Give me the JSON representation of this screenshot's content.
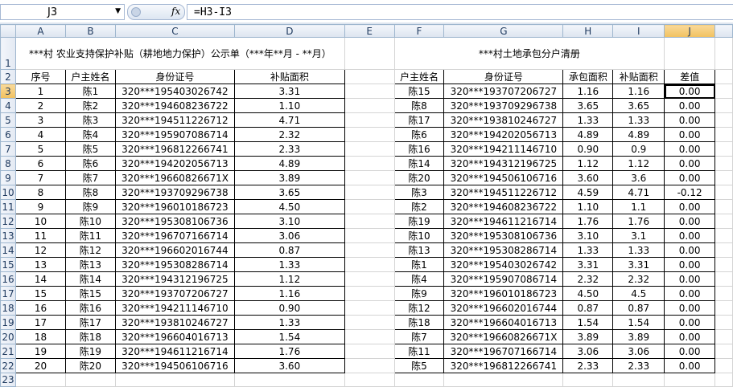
{
  "formula_bar": {
    "name_box": "J3",
    "fx_label": "fx",
    "formula": "=H3-I3"
  },
  "columns": [
    "A",
    "B",
    "C",
    "D",
    "E",
    "F",
    "G",
    "H",
    "I",
    "J"
  ],
  "rows": [
    "1",
    "2",
    "3",
    "4",
    "5",
    "6",
    "7",
    "8",
    "9",
    "10",
    "11",
    "12",
    "13",
    "14",
    "15",
    "16",
    "17",
    "18",
    "19",
    "20",
    "21",
    "22",
    "23"
  ],
  "left_table": {
    "title": "***村 农业支持保护补贴（耕地地力保护）公示单（***年**月 - **月）",
    "headers": [
      "序号",
      "户主姓名",
      "身份证号",
      "补贴面积"
    ],
    "rows": [
      [
        "1",
        "陈1",
        "320***195403026742",
        "3.31"
      ],
      [
        "2",
        "陈2",
        "320***194608236722",
        "1.10"
      ],
      [
        "3",
        "陈3",
        "320***194511226712",
        "4.71"
      ],
      [
        "4",
        "陈4",
        "320***195907086714",
        "2.32"
      ],
      [
        "5",
        "陈5",
        "320***196812266741",
        "2.33"
      ],
      [
        "6",
        "陈6",
        "320***194202056713",
        "4.89"
      ],
      [
        "7",
        "陈7",
        "320***19660826671X",
        "3.89"
      ],
      [
        "8",
        "陈8",
        "320***193709296738",
        "3.65"
      ],
      [
        "9",
        "陈9",
        "320***196010186723",
        "4.50"
      ],
      [
        "10",
        "陈10",
        "320***195308106736",
        "3.10"
      ],
      [
        "11",
        "陈11",
        "320***196707166714",
        "3.06"
      ],
      [
        "12",
        "陈12",
        "320***196602016744",
        "0.87"
      ],
      [
        "13",
        "陈13",
        "320***195308286714",
        "1.33"
      ],
      [
        "14",
        "陈14",
        "320***194312196725",
        "1.12"
      ],
      [
        "15",
        "陈15",
        "320***193707206727",
        "1.16"
      ],
      [
        "16",
        "陈16",
        "320***194211146710",
        "0.90"
      ],
      [
        "17",
        "陈17",
        "320***193810246727",
        "1.33"
      ],
      [
        "18",
        "陈18",
        "320***196604016713",
        "1.54"
      ],
      [
        "19",
        "陈19",
        "320***194611216714",
        "1.76"
      ],
      [
        "20",
        "陈20",
        "320***194506106716",
        "3.60"
      ]
    ]
  },
  "right_table": {
    "title": "***村土地承包分户清册",
    "headers": [
      "户主姓名",
      "身份证号",
      "承包面积",
      "补贴面积",
      "差值"
    ],
    "rows": [
      [
        "陈15",
        "320***193707206727",
        "1.16",
        "1.16",
        "0.00"
      ],
      [
        "陈8",
        "320***193709296738",
        "3.65",
        "3.65",
        "0.00"
      ],
      [
        "陈17",
        "320***193810246727",
        "1.33",
        "1.33",
        "0.00"
      ],
      [
        "陈6",
        "320***194202056713",
        "4.89",
        "4.89",
        "0.00"
      ],
      [
        "陈16",
        "320***194211146710",
        "0.90",
        "0.9",
        "0.00"
      ],
      [
        "陈14",
        "320***194312196725",
        "1.12",
        "1.12",
        "0.00"
      ],
      [
        "陈20",
        "320***194506106716",
        "3.60",
        "3.6",
        "0.00"
      ],
      [
        "陈3",
        "320***194511226712",
        "4.59",
        "4.71",
        "-0.12"
      ],
      [
        "陈2",
        "320***194608236722",
        "1.10",
        "1.1",
        "0.00"
      ],
      [
        "陈19",
        "320***194611216714",
        "1.76",
        "1.76",
        "0.00"
      ],
      [
        "陈10",
        "320***195308106736",
        "3.10",
        "3.1",
        "0.00"
      ],
      [
        "陈13",
        "320***195308286714",
        "1.33",
        "1.33",
        "0.00"
      ],
      [
        "陈1",
        "320***195403026742",
        "3.31",
        "3.31",
        "0.00"
      ],
      [
        "陈4",
        "320***195907086714",
        "2.32",
        "2.32",
        "0.00"
      ],
      [
        "陈9",
        "320***196010186723",
        "4.50",
        "4.5",
        "0.00"
      ],
      [
        "陈12",
        "320***196602016744",
        "0.87",
        "0.87",
        "0.00"
      ],
      [
        "陈18",
        "320***196604016713",
        "1.54",
        "1.54",
        "0.00"
      ],
      [
        "陈7",
        "320***19660826671X",
        "3.89",
        "3.89",
        "0.00"
      ],
      [
        "陈11",
        "320***196707166714",
        "3.06",
        "3.06",
        "0.00"
      ],
      [
        "陈5",
        "320***196812266741",
        "2.33",
        "2.33",
        "0.00"
      ]
    ]
  },
  "selected_cell": "J3",
  "colors": {
    "header_bg": "#dce4ef",
    "selected_header": "#f1c15f",
    "grid_line": "#d4d4d4"
  }
}
